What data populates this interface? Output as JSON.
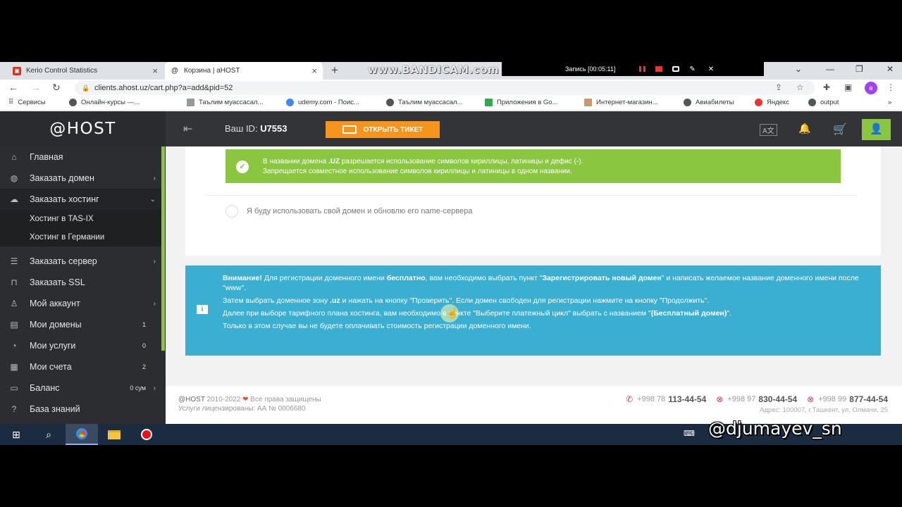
{
  "browser": {
    "tabs": [
      {
        "title": "Kerio Control Statistics",
        "active": false
      },
      {
        "title": "Корзина | aHOST",
        "active": true
      }
    ],
    "watermark": "www.BANDICAM.com",
    "recording": "Запись [00:05:11]",
    "url": "clients.ahost.uz/cart.php?a=add&pid=52",
    "profile_letter": "в",
    "bookmarks": [
      "Сервисы",
      "Онлайн-курсы —...",
      "Таълим муассасал...",
      "udemy.com - Поис...",
      "Таълим муассасал...",
      "Приложения в Go...",
      "Интернет-магазин...",
      "Авиабилеты",
      "Яндекс",
      "output"
    ]
  },
  "site": {
    "logo": "@HOST",
    "user_id_label": "Ваш ID:",
    "user_id": "U7553",
    "ticket_button": "ОТКРЫТЬ ТИКЕТ",
    "colors": {
      "accent_green": "#8ac640",
      "info_blue": "#3bafd2",
      "ticket_orange": "#f7941d",
      "sidebar": "#2b2d30"
    }
  },
  "sidebar": {
    "items": [
      {
        "label": "Главная",
        "icon": "home-icon"
      },
      {
        "label": "Заказать домен",
        "icon": "globe-icon",
        "has_children": true
      },
      {
        "label": "Заказать хостинг",
        "icon": "cloud-icon",
        "expanded": true
      },
      {
        "label": "Заказать сервер",
        "icon": "server-icon",
        "has_children": true
      },
      {
        "label": "Заказать SSL",
        "icon": "lock-icon"
      },
      {
        "label": "Мой аккаунт",
        "icon": "user-icon",
        "has_children": true
      },
      {
        "label": "Мои домены",
        "icon": "domain-icon",
        "count": "1"
      },
      {
        "label": "Мои услуги",
        "icon": "services-icon",
        "count": "0"
      },
      {
        "label": "Мои счета",
        "icon": "invoice-icon",
        "count": "2"
      },
      {
        "label": "Баланс",
        "icon": "wallet-icon",
        "count": "0 сум",
        "has_children": true
      },
      {
        "label": "База знаний",
        "icon": "help-icon"
      }
    ],
    "subitems": [
      "Хостинг в TAS-IX",
      "Хостинг в Германии"
    ]
  },
  "main": {
    "green_notice_line1_pre": "В названии домена ",
    "green_notice_line1_bold": ".UZ",
    "green_notice_line1_post": " разрешается использование символов кириллицы, латиницы и дефис (-).",
    "green_notice_line2": "Запрещается совместное использование символов кириллицы и латиницы в одном названии.",
    "radio_option": "Я буду использовать свой домен и обновлю его name-сервера",
    "info": {
      "p1_bold": "Внимание!",
      "p1_a": " Для регистрации доменного имени ",
      "p1_bold2": "бесплатно",
      "p1_b": ", вам необходимо выбрать пункт \"",
      "p1_bold3": "Зарегистрировать новый домен",
      "p1_c": "\" и написать желаемое название доменного имени после \"www\".",
      "p2_a": "Затем выбрать доменное зону ",
      "p2_bold": ".uz",
      "p2_b": " и нажать на кнопку \"Проверить\". Если домен свободен для регистрации нажмите на кнопку \"Продолжить\".",
      "p3_a": "Далее при выборе тарифного плана хостинга, вам необходимо в пункте \"Выберите платежный цикл\" выбрать с названием \"",
      "p3_bold": "(Бесплатный домен)",
      "p3_b": "\".",
      "p4": "Только в этом случае вы не будете оплачивать стоимость регистрации доменного имени."
    }
  },
  "footer": {
    "brand": "@HOST",
    "years": " 2010-2022 ",
    "rights": " Все права защищены",
    "license": "Услуги лицензированы: АА № 0006680",
    "phones": [
      {
        "prefix": "+998 78",
        "number": "113-44-54"
      },
      {
        "prefix": "+998 97",
        "number": "830-44-54"
      },
      {
        "prefix": "+998 99",
        "number": "877-44-54"
      }
    ],
    "address": "Адрес: 100007, г.Ташкент, ул. Олмачи, 25"
  },
  "overlay_handle": "@djumayev_sn"
}
